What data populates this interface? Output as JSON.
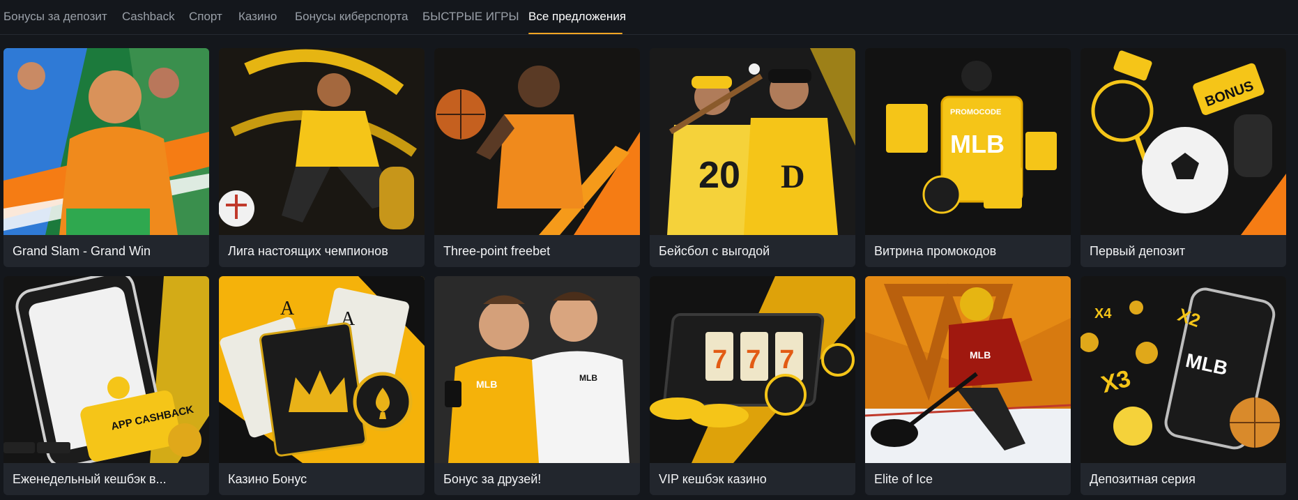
{
  "tabs": [
    {
      "label": "Бонусы за депозит"
    },
    {
      "label": "Cashback"
    },
    {
      "label": "Спорт"
    },
    {
      "label": "Казино"
    },
    {
      "label": "Бонусы киберспорта"
    },
    {
      "label": "БЫСТРЫЕ ИГРЫ"
    },
    {
      "label": "Все предложения",
      "active": true
    }
  ],
  "colors": {
    "background": "#14171c",
    "card": "#22262d",
    "accent_yellow": "#f5c518",
    "accent_orange": "#f57c14",
    "active_underline": "#f5a623"
  },
  "offers": [
    {
      "title": "Grand Slam - Grand Win",
      "art_text": ""
    },
    {
      "title": "Лига настоящих чемпионов",
      "art_text": ""
    },
    {
      "title": "Three-point freebet",
      "art_text": ""
    },
    {
      "title": "Бейсбол с выгодой",
      "art_text": "20"
    },
    {
      "title": "Витрина промокодов",
      "art_text": "MLB",
      "art_text2": "PROMOCODE"
    },
    {
      "title": "Первый депозит",
      "art_text": "BONUS"
    },
    {
      "title": "Еженедельный кешбэк в...",
      "art_text": "APP CASHBACK"
    },
    {
      "title": "Казино Бонус",
      "art_text": "A"
    },
    {
      "title": "Бонус за друзей!",
      "art_text": "MLB"
    },
    {
      "title": "VIP кешбэк казино",
      "art_text": "777"
    },
    {
      "title": "Elite of Ice",
      "art_text": "MLB"
    },
    {
      "title": "Депозитная серия",
      "art_text": "MLB",
      "art_text2": "X3"
    }
  ]
}
